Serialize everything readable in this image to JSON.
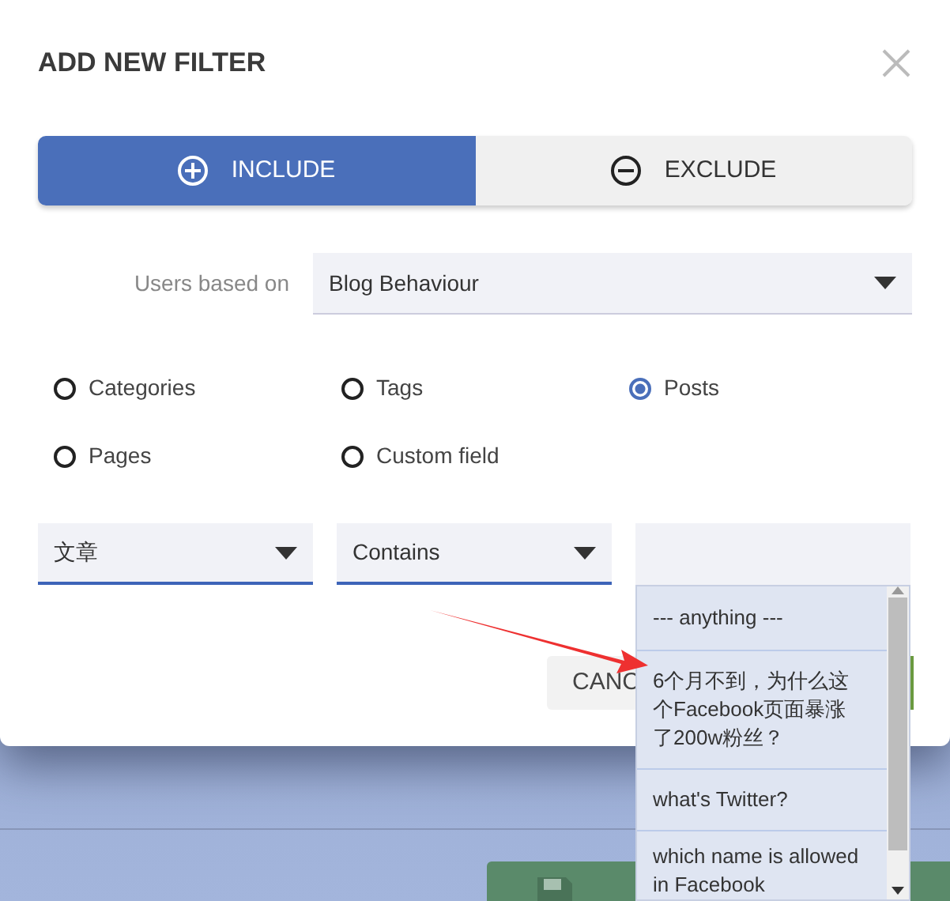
{
  "dialog": {
    "title": "ADD NEW FILTER",
    "mode_tabs": [
      {
        "label": "INCLUDE",
        "kind": "include",
        "selected": true
      },
      {
        "label": "EXCLUDE",
        "kind": "exclude",
        "selected": false
      }
    ],
    "users_based_on": {
      "label": "Users based on",
      "value": "Blog Behaviour"
    },
    "radios": [
      {
        "label": "Categories",
        "selected": false
      },
      {
        "label": "Tags",
        "selected": false
      },
      {
        "label": "Posts",
        "selected": true
      },
      {
        "label": "Pages",
        "selected": false
      },
      {
        "label": "Custom field",
        "selected": false
      }
    ],
    "condition": {
      "field": "文章",
      "operator": "Contains"
    },
    "suggestions": [
      {
        "label": "--- anything ---"
      },
      {
        "label": "6个月不到，为什么这个Facebook页面暴涨了200w粉丝？"
      },
      {
        "label": "what's Twitter?"
      },
      {
        "label": "which name is allowed in Facebook"
      }
    ],
    "cancel_button": "CANC"
  }
}
